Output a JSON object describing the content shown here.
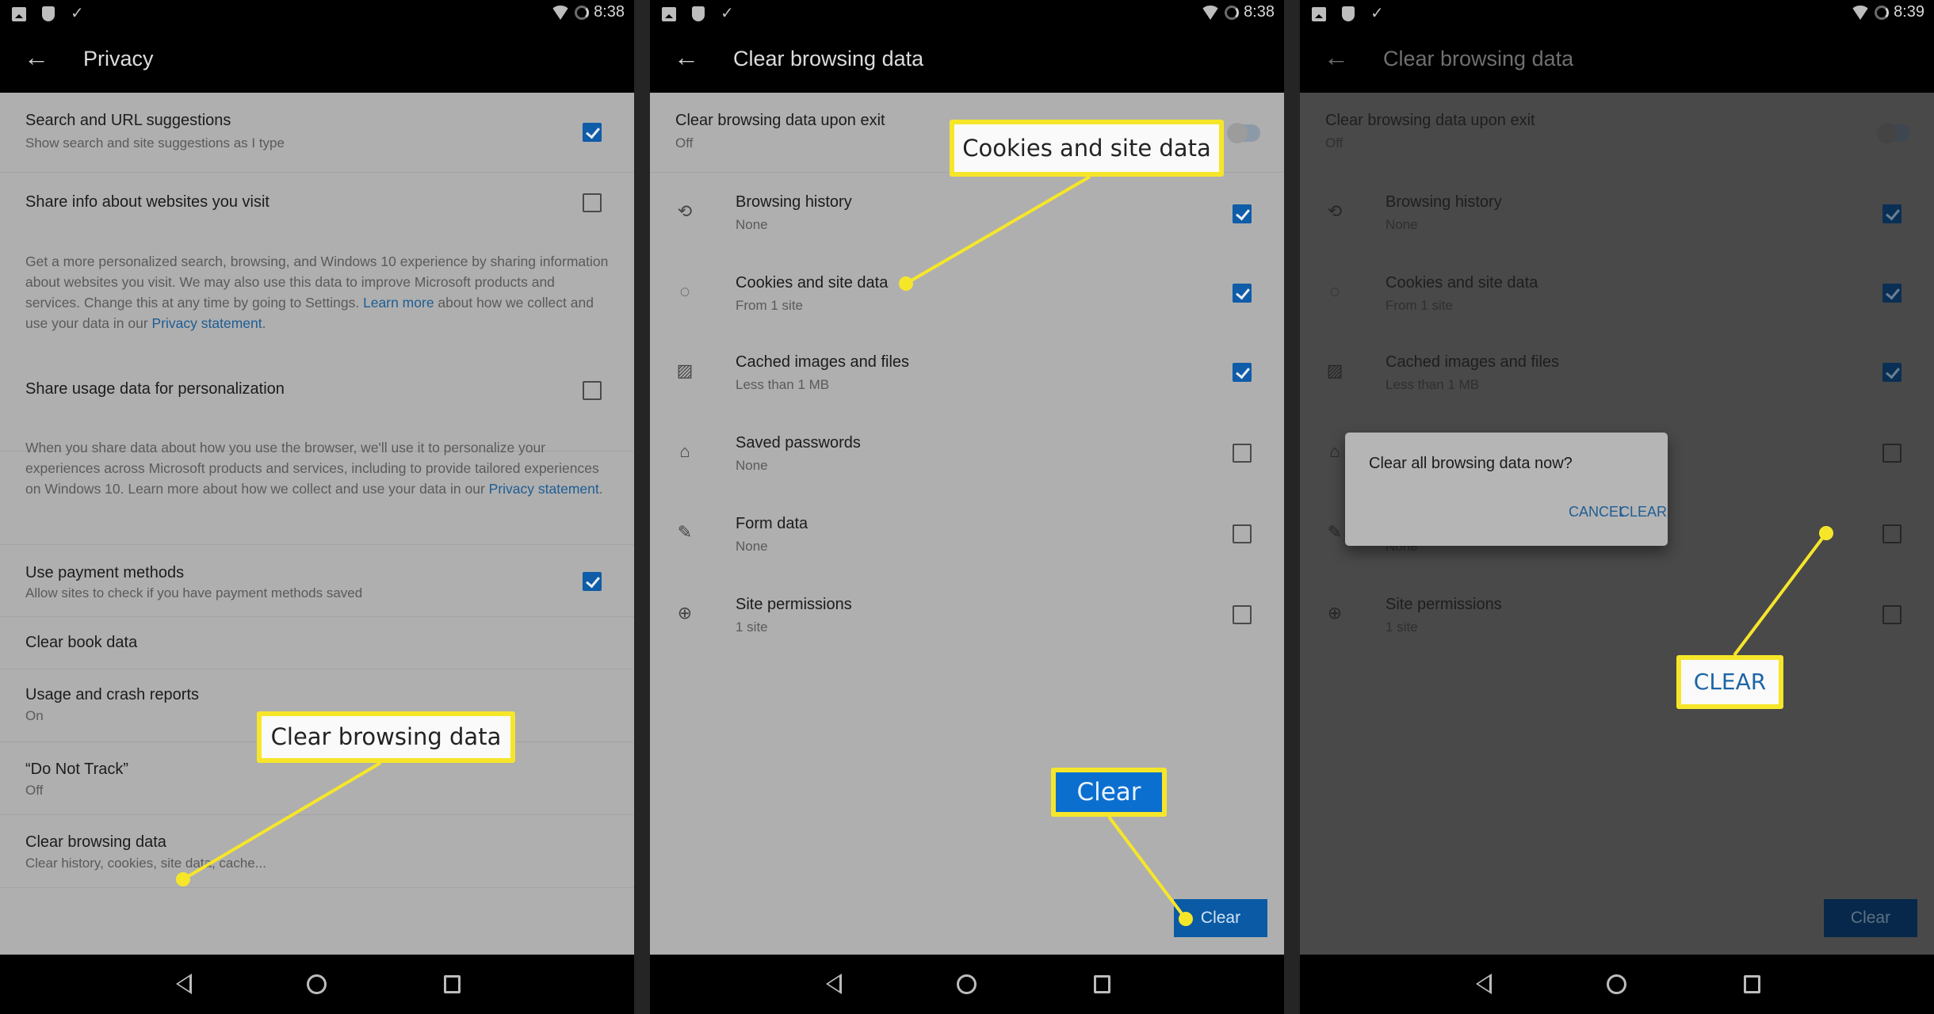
{
  "panels": [
    {
      "status": {
        "time": "8:38"
      },
      "appbar": {
        "title": "Privacy"
      },
      "rows": [
        {
          "title": "Search and URL suggestions",
          "subtitle": "Show search and site suggestions as I type",
          "checked": true
        },
        {
          "title": "Share info about websites you visit",
          "checked": false
        },
        {
          "desc_parts": [
            "Get a more personalized search, browsing, and Windows 10 experience by sharing information about websites you visit. We may also use this data to improve Microsoft products and services. Change this at any time by going to Settings. ",
            "Learn more",
            " about how we collect and use your data in our ",
            "Privacy statement",
            "."
          ]
        },
        {
          "title": "Share usage data for personalization",
          "checked": false
        },
        {
          "desc_parts": [
            "When you share data about how you use the browser, we'll use it to personalize your experiences across Microsoft products and services, including to provide tailored experiences on Windows 10. Learn more about how we collect and use your data in our ",
            "Privacy statement",
            "."
          ]
        },
        {
          "title": "Use payment methods",
          "subtitle": "Allow sites to check if you have payment methods saved",
          "checked": true
        },
        {
          "title": "Clear book data"
        },
        {
          "title": "Usage and crash reports",
          "subtitle": "On"
        },
        {
          "title": "“Do Not Track”",
          "subtitle": "Off"
        },
        {
          "title": "Clear browsing data",
          "subtitle": "Clear history, cookies, site data, cache..."
        }
      ],
      "callout": "Clear browsing data"
    },
    {
      "status": {
        "time": "8:38"
      },
      "appbar": {
        "title": "Clear browsing data"
      },
      "exit_toggle": {
        "title": "Clear browsing data upon exit",
        "value": "Off",
        "on": false
      },
      "items": [
        {
          "icon": "history-icon",
          "glyph": "⟲",
          "title": "Browsing history",
          "subtitle": "None",
          "checked": true
        },
        {
          "icon": "cookie-icon",
          "glyph": "◌",
          "title": "Cookies and site data",
          "subtitle": "From 1 site",
          "checked": true
        },
        {
          "icon": "image-icon",
          "glyph": "▨",
          "title": "Cached images and files",
          "subtitle": "Less than 1 MB",
          "checked": true
        },
        {
          "icon": "lock-icon",
          "glyph": "⌂",
          "title": "Saved passwords",
          "subtitle": "None",
          "checked": false
        },
        {
          "icon": "pencil-icon",
          "glyph": "✎",
          "title": "Form data",
          "subtitle": "None",
          "checked": false
        },
        {
          "icon": "globe-icon",
          "glyph": "⊕",
          "title": "Site permissions",
          "subtitle": "1 site",
          "checked": false
        }
      ],
      "clear_button": "Clear",
      "callouts": {
        "cookies": "Cookies and site data",
        "clear": "Clear"
      }
    },
    {
      "status": {
        "time": "8:39"
      },
      "appbar": {
        "title": "Clear browsing data"
      },
      "dialog": {
        "message": "Clear all browsing data now?",
        "cancel": "CANCEL",
        "confirm": "CLEAR"
      },
      "callout": "CLEAR"
    }
  ],
  "colors": {
    "accent": "#0f5ca8",
    "callout_border": "#f6e62a",
    "link": "#1d5d95"
  }
}
